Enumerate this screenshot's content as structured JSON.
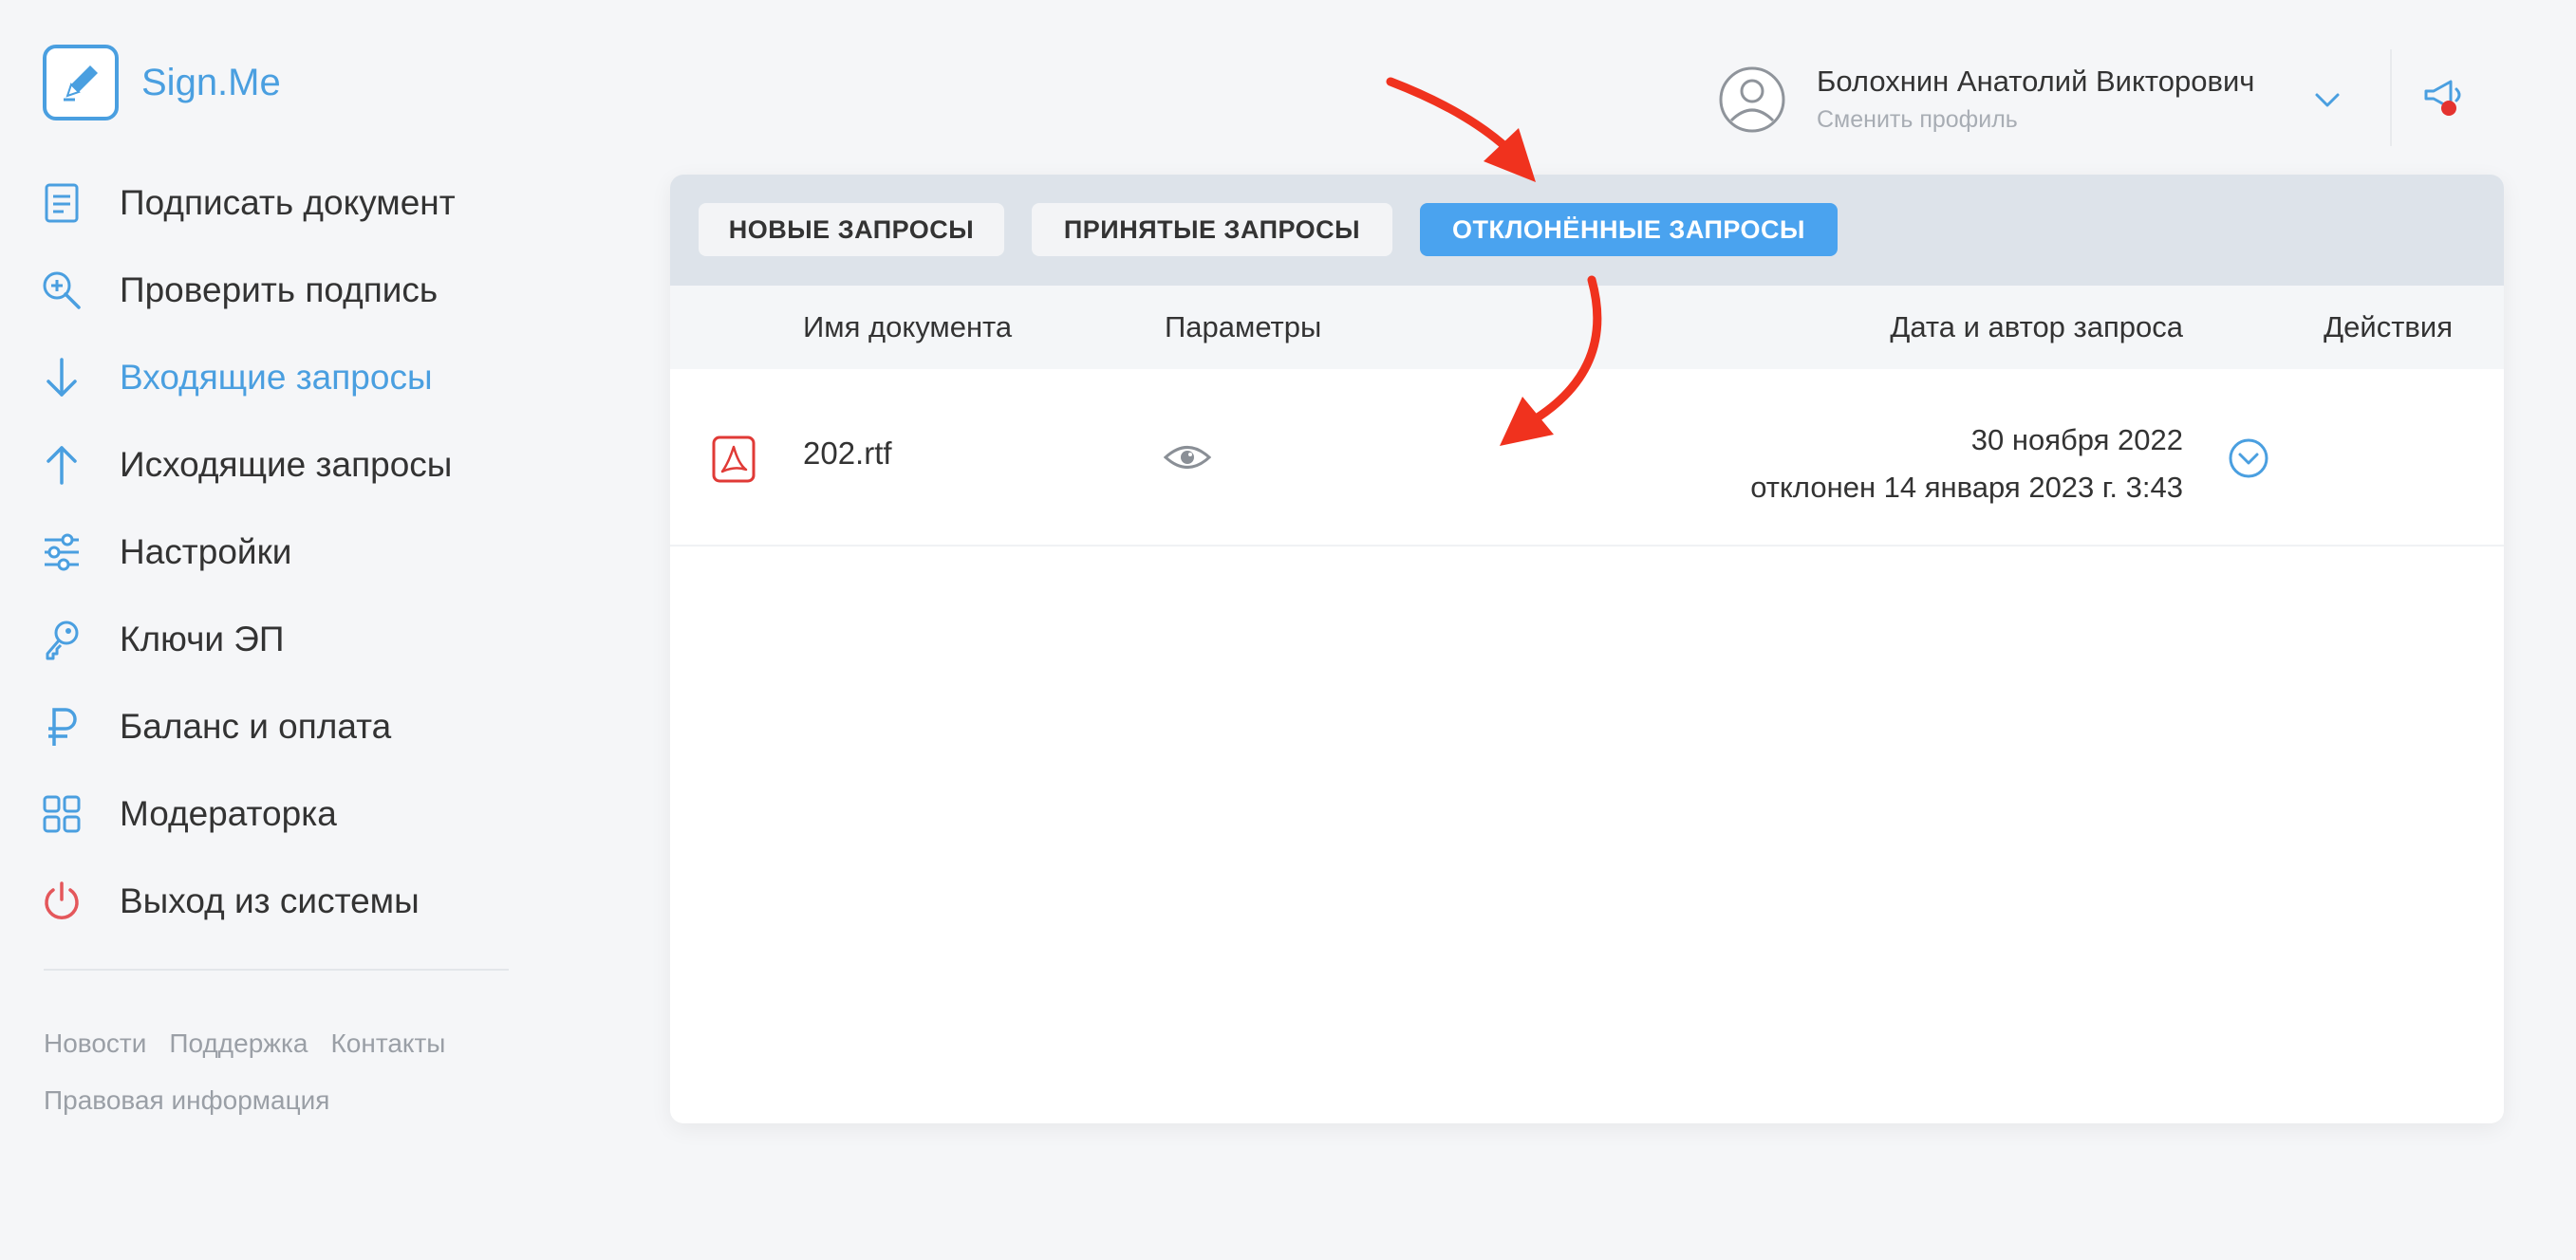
{
  "app": {
    "name": "Sign.Me"
  },
  "nav": {
    "items": [
      {
        "label": "Подписать документ",
        "icon": "document-icon"
      },
      {
        "label": "Проверить подпись",
        "icon": "magnifier-plus-icon"
      },
      {
        "label": "Входящие запросы",
        "icon": "arrow-down-icon",
        "active": true
      },
      {
        "label": "Исходящие запросы",
        "icon": "arrow-up-icon"
      },
      {
        "label": "Настройки",
        "icon": "sliders-icon"
      },
      {
        "label": "Ключи ЭП",
        "icon": "key-icon"
      },
      {
        "label": "Баланс и оплата",
        "icon": "ruble-icon"
      },
      {
        "label": "Модераторка",
        "icon": "grid-icon"
      },
      {
        "label": "Выход из системы",
        "icon": "power-icon"
      }
    ]
  },
  "footer": {
    "links": [
      "Новости",
      "Поддержка",
      "Контакты"
    ],
    "legal": "Правовая информация"
  },
  "profile": {
    "name": "Болохнин Анатолий Викторович",
    "switch_label": "Сменить профиль"
  },
  "tabs": [
    {
      "label": "НОВЫЕ ЗАПРОСЫ"
    },
    {
      "label": "ПРИНЯТЫЕ ЗАПРОСЫ"
    },
    {
      "label": "ОТКЛОНЁННЫЕ ЗАПРОСЫ",
      "active": true
    }
  ],
  "table": {
    "columns": [
      "Имя документа",
      "Параметры",
      "Дата и автор запроса",
      "Действия"
    ],
    "rows": [
      {
        "file": "202.rtf",
        "date": "30 ноября 2022",
        "status": "отклонен 14 января 2023 г. 3:43"
      }
    ]
  },
  "colors": {
    "accent": "#4a9fe0",
    "tab_active": "#4aa3ef",
    "annotation_arrow": "#f0321e",
    "logout": "#e4575b",
    "pdf": "#e03a36"
  }
}
